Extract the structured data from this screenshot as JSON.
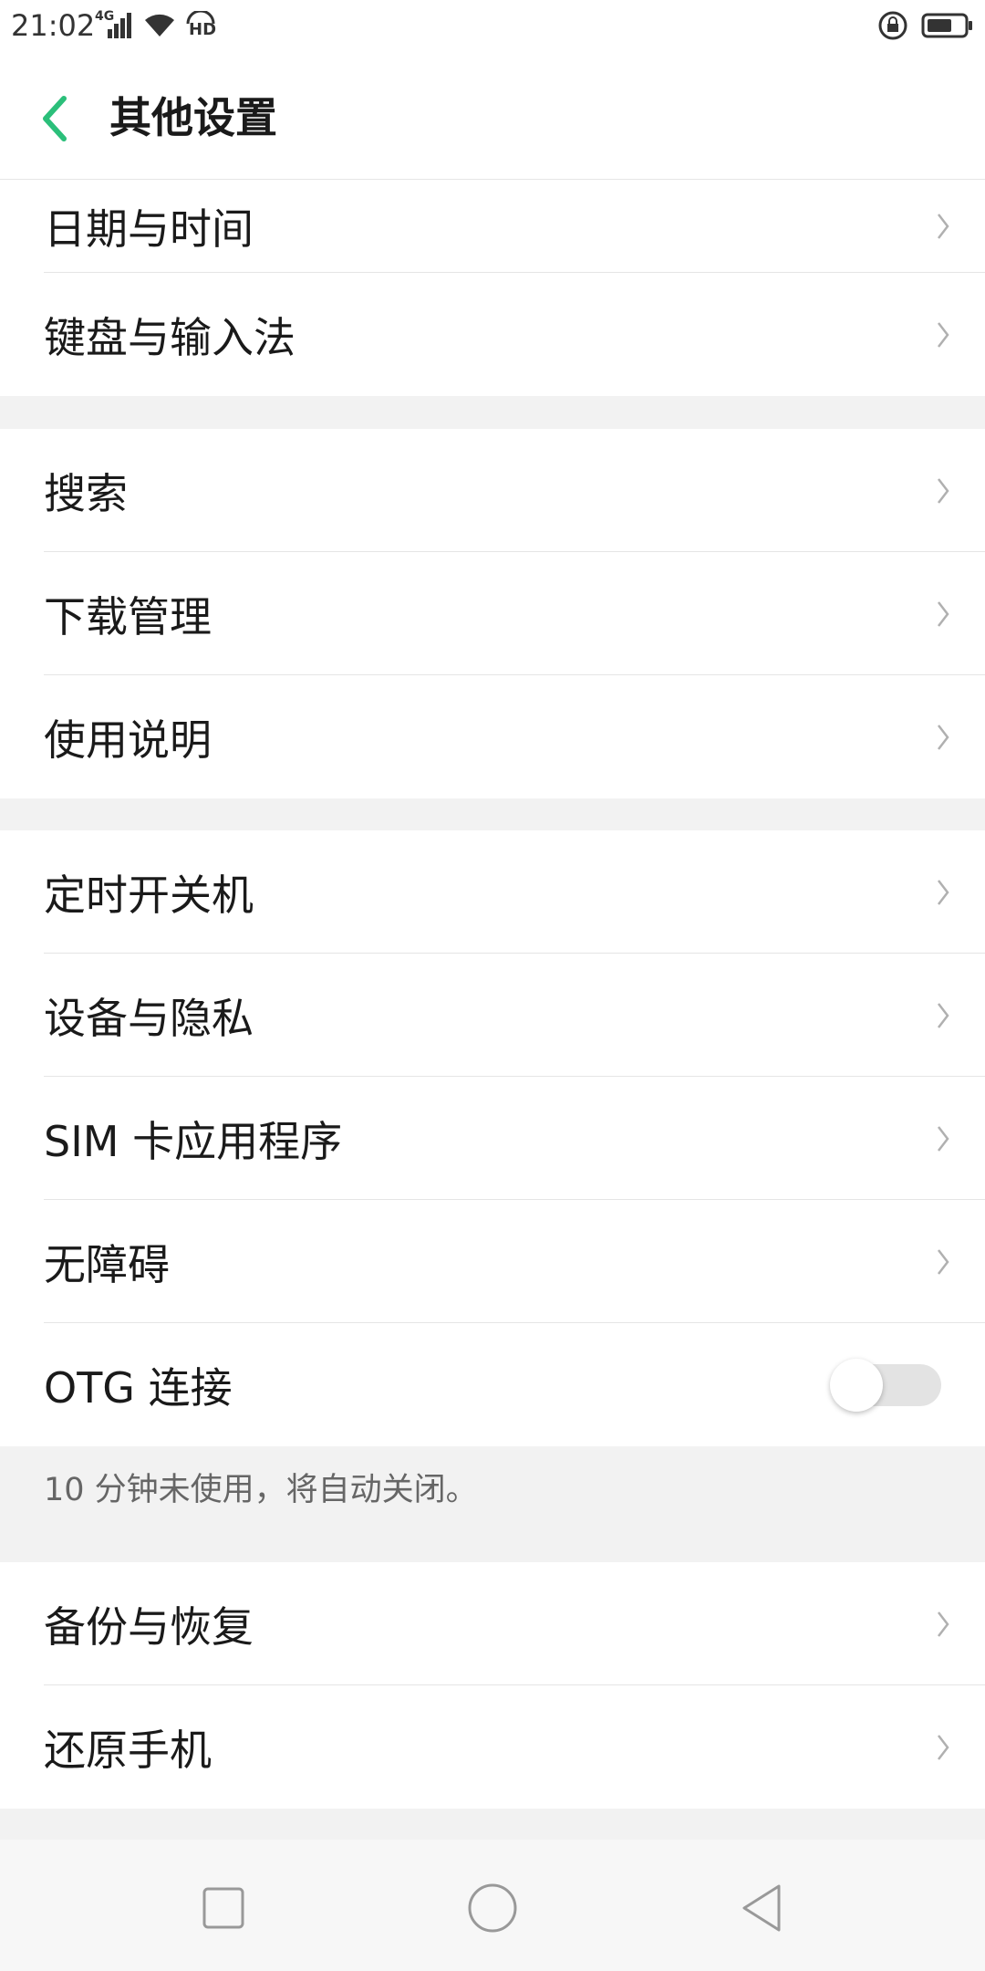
{
  "status_bar": {
    "time": "21:02",
    "network_label": "4G",
    "hd_label": "HD"
  },
  "header": {
    "title": "其他设置"
  },
  "sections": [
    {
      "items": [
        {
          "label": "日期与时间"
        },
        {
          "label": "键盘与输入法"
        }
      ]
    },
    {
      "items": [
        {
          "label": "搜索"
        },
        {
          "label": "下载管理"
        },
        {
          "label": "使用说明"
        }
      ]
    },
    {
      "items": [
        {
          "label": "定时开关机"
        },
        {
          "label": "设备与隐私"
        },
        {
          "label": "SIM 卡应用程序"
        },
        {
          "label": "无障碍"
        },
        {
          "label": "OTG 连接",
          "toggle": "off"
        }
      ]
    },
    {
      "items": [
        {
          "label": "备份与恢复"
        },
        {
          "label": "还原手机"
        }
      ]
    }
  ],
  "otg_note": "10 分钟未使用，将自动关闭。",
  "icons": {
    "back": "chevron-left-icon",
    "chevron": "chevron-right-icon",
    "nav_recents": "square-icon",
    "nav_home": "circle-icon",
    "nav_back": "triangle-back-icon"
  },
  "colors": {
    "accent": "#2bbf7a",
    "background": "#f2f2f2",
    "toggle_off_track": "#e3e3e3"
  }
}
